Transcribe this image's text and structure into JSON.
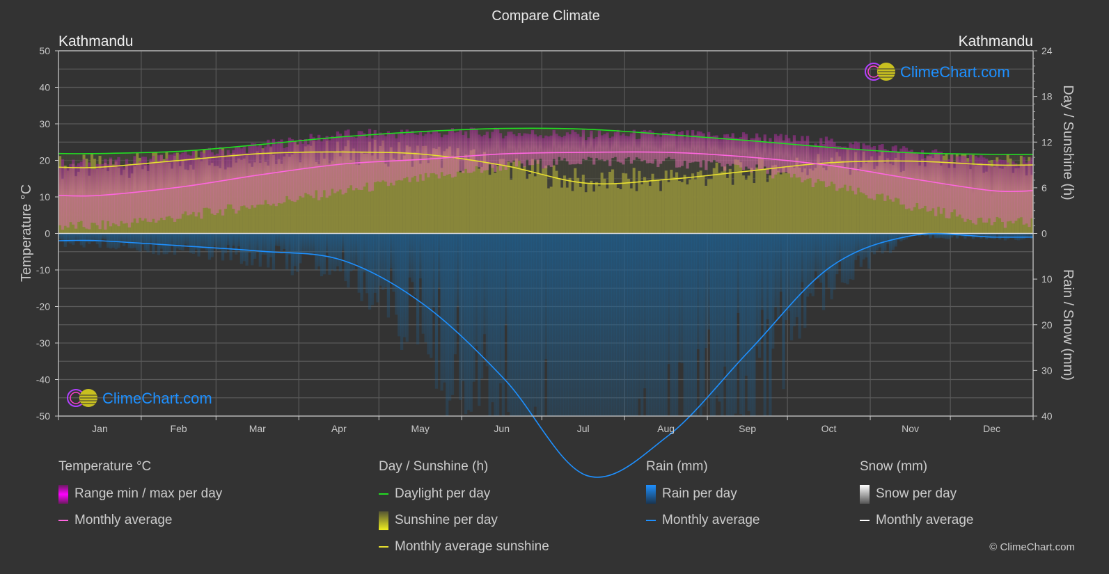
{
  "title": "Compare Climate",
  "city_left": "Kathmandu",
  "city_right": "Kathmandu",
  "logo_text": "ClimeChart.com",
  "copyright": "© ClimeChart.com",
  "colors": {
    "background": "#333333",
    "temp_avg": "#ff66e0",
    "temp_range": "#d65cba",
    "daylight": "#22dd22",
    "sunshine_avg": "#e8e030",
    "sunshine_fill": "#8c8a3a",
    "rain": "#1e90ff",
    "rain_fill": "#1f5f8f",
    "snow": "#ffffff",
    "logo_blue": "#1e90ff"
  },
  "legend": {
    "temperature": {
      "heading": "Temperature °C",
      "range_label": "Range min / max per day",
      "avg_label": "Monthly average"
    },
    "sunshine": {
      "heading": "Day / Sunshine (h)",
      "daylight_label": "Daylight per day",
      "sunshine_label": "Sunshine per day",
      "avg_label": "Monthly average sunshine"
    },
    "rain": {
      "heading": "Rain (mm)",
      "per_day_label": "Rain per day",
      "avg_label": "Monthly average"
    },
    "snow": {
      "heading": "Snow (mm)",
      "per_day_label": "Snow per day",
      "avg_label": "Monthly average"
    }
  },
  "chart_data": {
    "type": "line",
    "title": "Compare Climate",
    "categories": [
      "Jan",
      "Feb",
      "Mar",
      "Apr",
      "May",
      "Jun",
      "Jul",
      "Aug",
      "Sep",
      "Oct",
      "Nov",
      "Dec"
    ],
    "axes": {
      "left": {
        "label": "Temperature °C",
        "range": [
          -50,
          50
        ],
        "ticks": [
          50,
          40,
          30,
          20,
          10,
          0,
          -10,
          -20,
          -30,
          -40,
          -50
        ]
      },
      "right_top": {
        "label": "Day / Sunshine (h)",
        "range": [
          0,
          24
        ],
        "ticks": [
          24,
          18,
          12,
          6,
          0
        ]
      },
      "right_bottom": {
        "label": "Rain / Snow (mm)",
        "range": [
          0,
          40
        ],
        "ticks": [
          0,
          10,
          20,
          30,
          40
        ]
      }
    },
    "grid": true,
    "series": [
      {
        "name": "Temperature monthly average (°C)",
        "axis": "left",
        "values": [
          10.4,
          12.7,
          16.1,
          19.0,
          20.3,
          21.8,
          22.2,
          22.2,
          20.9,
          18.6,
          15.0,
          11.7
        ]
      },
      {
        "name": "Temperature daily max approx (°C)",
        "axis": "left",
        "values": [
          19.0,
          21.0,
          24.0,
          27.0,
          27.5,
          27.5,
          27.0,
          27.0,
          26.5,
          25.0,
          22.5,
          19.5
        ]
      },
      {
        "name": "Temperature daily min approx (°C)",
        "axis": "left",
        "values": [
          2.0,
          4.5,
          8.0,
          11.5,
          15.0,
          18.5,
          20.0,
          19.5,
          18.0,
          13.0,
          7.5,
          3.0
        ]
      },
      {
        "name": "Daylight per day (h)",
        "axis": "right_top",
        "values": [
          10.5,
          10.8,
          11.7,
          12.7,
          13.4,
          13.8,
          13.7,
          13.0,
          12.2,
          11.3,
          10.6,
          10.4
        ]
      },
      {
        "name": "Monthly average sunshine (h)",
        "axis": "right_top",
        "values": [
          8.7,
          9.6,
          10.5,
          10.7,
          10.4,
          8.9,
          6.6,
          7.1,
          8.2,
          9.3,
          9.5,
          9.0
        ]
      },
      {
        "name": "Rain monthly average (mm)",
        "axis": "right_bottom",
        "values": [
          1.6,
          2.7,
          3.9,
          5.9,
          15.6,
          32.1,
          53.0,
          44.4,
          25.8,
          7.4,
          0.5,
          0.8
        ]
      },
      {
        "name": "Snow monthly average (mm)",
        "axis": "right_bottom",
        "values": [
          0,
          0,
          0,
          0,
          0,
          0,
          0,
          0,
          0,
          0,
          0,
          0
        ]
      }
    ],
    "legend_position": "bottom"
  }
}
